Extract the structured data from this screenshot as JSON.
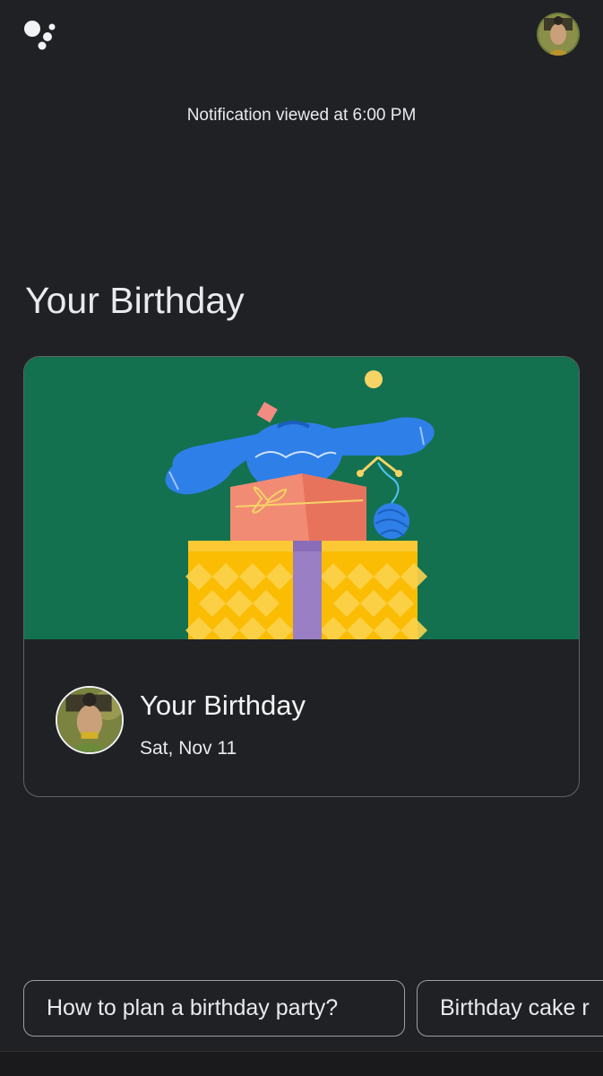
{
  "header": {
    "logo_icon": "google-assistant-dots-icon",
    "profile_icon": "profile-avatar"
  },
  "notification": {
    "status_text": "Notification viewed at 6:00 PM"
  },
  "section": {
    "title": "Your Birthday"
  },
  "card": {
    "illustration": "gift-boxes-with-sweater-and-yarn",
    "title": "Your Birthday",
    "date": "Sat, Nov 11"
  },
  "suggestions": [
    {
      "label": "How to plan a birthday party?"
    },
    {
      "label": "Birthday cake r"
    }
  ],
  "colors": {
    "background": "#202124",
    "card_illustration_bg": "#137150",
    "text_primary": "#e8eaed",
    "chip_border": "#9aa0a6"
  }
}
